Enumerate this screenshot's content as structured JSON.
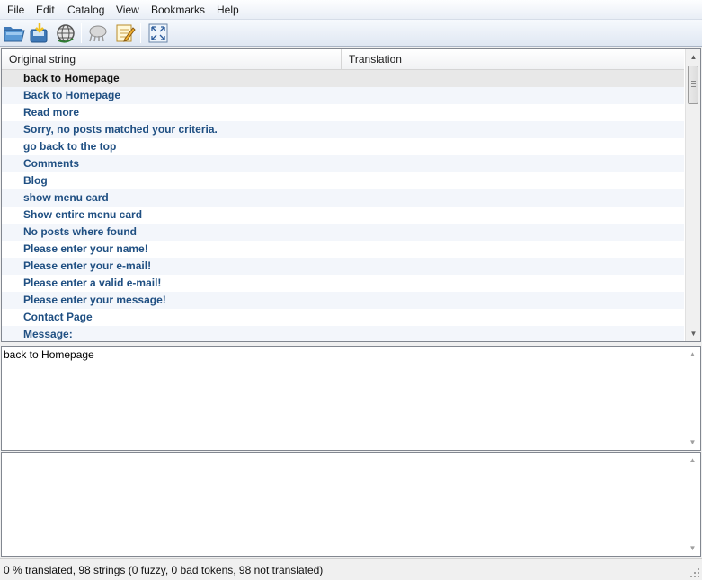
{
  "menu": [
    "File",
    "Edit",
    "Catalog",
    "View",
    "Bookmarks",
    "Help"
  ],
  "toolbar": {
    "open_icon": "folder-open-icon",
    "save_icon": "save-icon",
    "update_icon": "globe-update-icon",
    "validate_icon": "validate-icon",
    "comment_icon": "edit-comment-icon",
    "fullscreen_icon": "fullscreen-icon"
  },
  "list": {
    "columns": [
      "Original string",
      "Translation"
    ],
    "rows": [
      "back to Homepage",
      "Back to Homepage",
      "Read more",
      "Sorry, no posts matched your criteria.",
      "go back to the top",
      "Comments",
      "Blog",
      "show menu card",
      "Show entire menu card",
      "No posts where found",
      "Please enter your name!",
      "Please enter your e-mail!",
      "Please enter a valid e-mail!",
      "Please enter your message!",
      "Contact Page",
      "Message:"
    ],
    "selected_index": 0
  },
  "source_pane": {
    "text": "back to Homepage"
  },
  "translation_pane": {
    "text": ""
  },
  "status": {
    "text": "0 % translated, 98 strings (0 fuzzy, 0 bad tokens, 98 not translated)"
  },
  "colors": {
    "row_text": "#1f4f82",
    "toolbar_bg": "#dfe7f2",
    "alt_row": "#f3f6fb"
  }
}
